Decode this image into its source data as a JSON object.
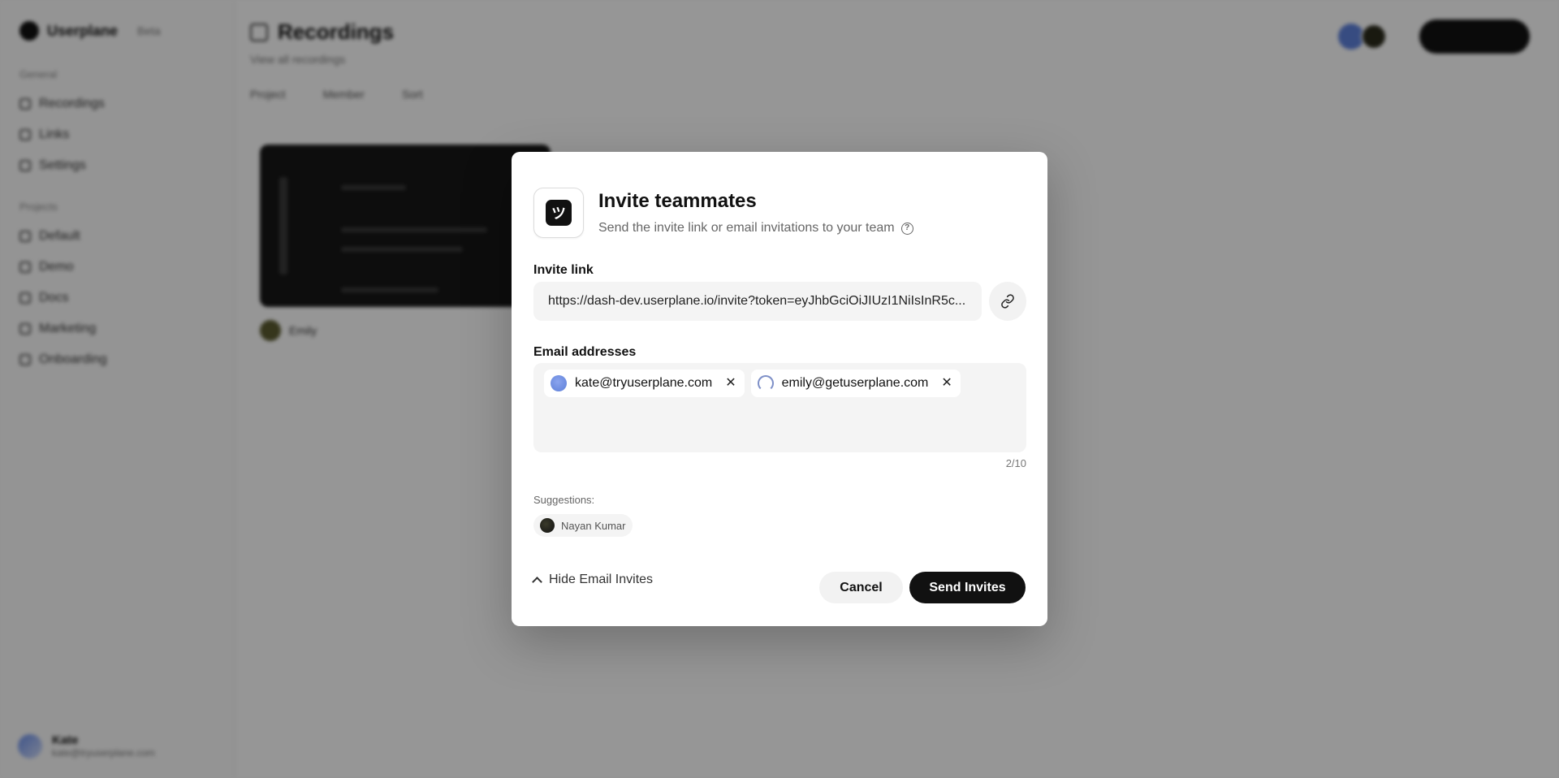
{
  "app": {
    "brand_name": "Userplane",
    "brand_tag": "Beta",
    "sidebar": {
      "section_1": "General",
      "items_1": [
        "Recordings",
        "Links",
        "Settings"
      ],
      "section_2": "Projects",
      "items_2": [
        "Default",
        "Demo",
        "Docs",
        "Marketing",
        "Onboarding"
      ],
      "user_name": "Kate",
      "user_email": "kate@tryuserplane.com"
    },
    "main": {
      "title": "Recordings",
      "subtitle": "View all recordings",
      "filters": [
        "Project",
        "Member",
        "Sort"
      ],
      "card_author": "Emily"
    }
  },
  "modal": {
    "title": "Invite teammates",
    "subtitle": "Send the invite link or email invitations to your team",
    "invite_link_label": "Invite link",
    "invite_link_value": "https://dash-dev.userplane.io/invite?token=eyJhbGciOiJIUzI1NiIsInR5c...",
    "email_label": "Email addresses",
    "emails": [
      {
        "address": "kate@tryuserplane.com",
        "avatar": "kate-avatar"
      },
      {
        "address": "emily@getuserplane.com",
        "avatar": "emily-avatar"
      }
    ],
    "counter": "2/10",
    "suggestions_label": "Suggestions:",
    "suggestions": [
      "Nayan Kumar"
    ],
    "hide_label": "Hide Email Invites",
    "cancel_label": "Cancel",
    "send_label": "Send Invites",
    "icons": {
      "logo": "userplane-logo-icon",
      "help": "help-circle-icon",
      "copy": "link-icon",
      "remove": "close-icon",
      "collapse": "chevron-up-icon"
    },
    "colors": {
      "primary": "#111111",
      "field_bg": "#f4f4f4",
      "overlay": "rgba(0,0,0,0.4)"
    }
  }
}
